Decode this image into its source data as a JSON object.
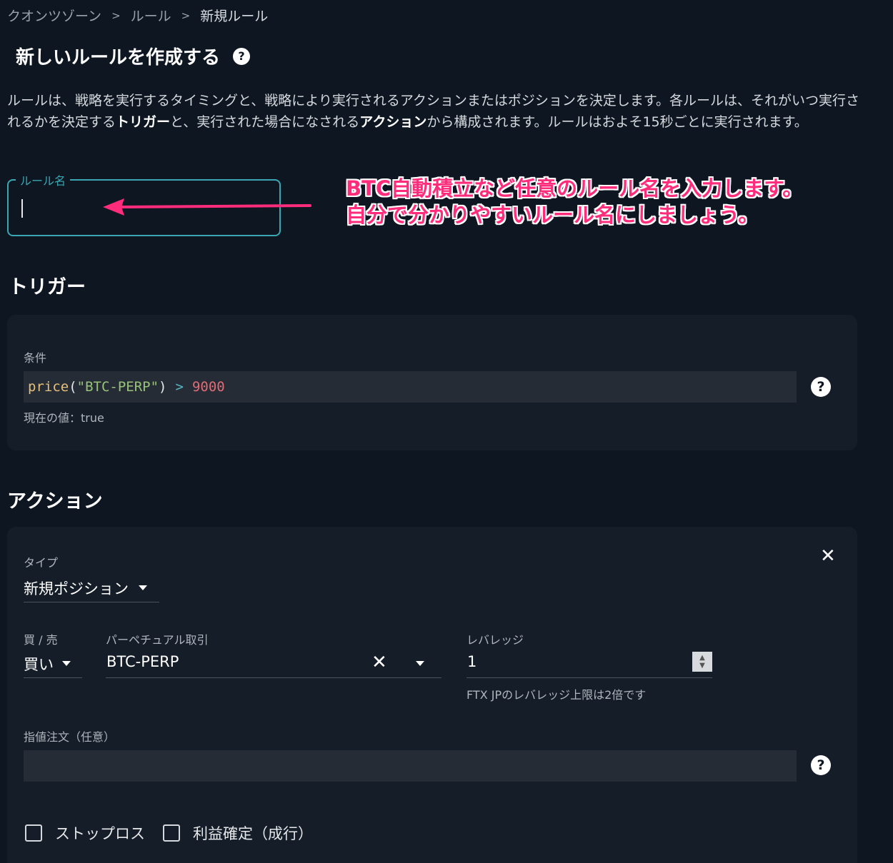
{
  "breadcrumb": {
    "items": [
      "クオンツゾーン",
      "ルール",
      "新規ルール"
    ],
    "sep": ">"
  },
  "page": {
    "title": "新しいルールを作成する",
    "help_glyph": "?",
    "desc_1": "ルールは、戦略を実行するタイミングと、戦略により実行されるアクションまたはポジションを決定します。各ルールは、それがいつ実行されるかを決定する",
    "desc_trigger": "トリガー",
    "desc_2": "と、実行された場合になされる",
    "desc_action": "アクション",
    "desc_3": "から構成されます。ルールはおよそ15秒ごとに実行されます。"
  },
  "rule_name": {
    "label": "ルール名",
    "value": ""
  },
  "annotation": {
    "line1": "BTC自動積立など任意のルール名を入力します。",
    "line2": "自分で分かりやすいルール名にしましょう。",
    "color": "#ff2c7c"
  },
  "trigger": {
    "heading": "トリガー",
    "condition_label": "条件",
    "code": {
      "fn": "price",
      "open": "(",
      "arg": "\"BTC-PERP\"",
      "close": ")",
      "op": ">",
      "num": "9000"
    },
    "current_value": "現在の値：true"
  },
  "action": {
    "heading": "アクション",
    "close_glyph": "✕",
    "type_label": "タイプ",
    "type_value": "新規ポジション",
    "side_label": "買 / 売",
    "side_value": "買い",
    "perp_label": "パーペチュアル取引",
    "perp_value": "BTC-PERP",
    "clear_glyph": "✕",
    "leverage_label": "レバレッジ",
    "leverage_value": "1",
    "leverage_hint": "FTX JPのレバレッジ上限は2倍です",
    "limit_label": "指値注文（任意）",
    "limit_value": "",
    "stoploss_label": "ストップロス",
    "takeprofit_label": "利益確定（成行）"
  },
  "colors": {
    "accent": "#3aa7b3",
    "background": "#0e1622",
    "card": "#151d29",
    "input": "#252c36"
  }
}
